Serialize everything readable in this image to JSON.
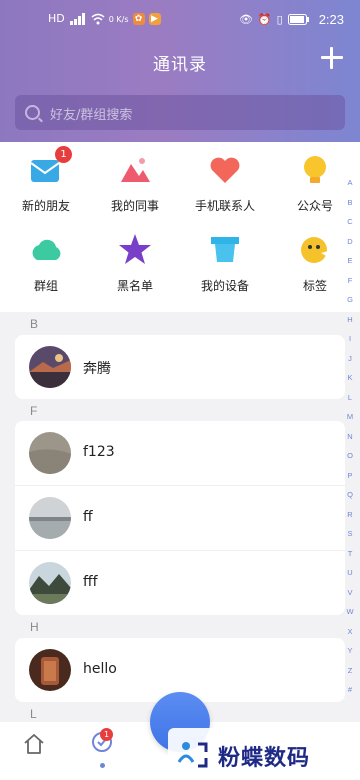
{
  "status_bar": {
    "left_text": "HD",
    "speed": "0 K/s",
    "time": "2:23"
  },
  "header": {
    "title": "通讯录"
  },
  "search": {
    "placeholder": "好友/群组搜索"
  },
  "quick_actions": [
    {
      "label": "新的朋友",
      "icon": "envelope-icon",
      "badge": "1"
    },
    {
      "label": "我的同事",
      "icon": "colleagues-icon"
    },
    {
      "label": "手机联系人",
      "icon": "heart-icon"
    },
    {
      "label": "公众号",
      "icon": "lightbulb-icon"
    },
    {
      "label": "群组",
      "icon": "cloud-icon"
    },
    {
      "label": "黑名单",
      "icon": "star-icon"
    },
    {
      "label": "我的设备",
      "icon": "device-icon"
    },
    {
      "label": "标签",
      "icon": "tag-icon"
    }
  ],
  "index_letters": [
    "A",
    "B",
    "C",
    "D",
    "E",
    "F",
    "G",
    "H",
    "I",
    "J",
    "K",
    "L",
    "M",
    "N",
    "O",
    "P",
    "Q",
    "R",
    "S",
    "T",
    "U",
    "V",
    "W",
    "X",
    "Y",
    "Z",
    "#"
  ],
  "sections": [
    {
      "letter": "B",
      "contacts": [
        {
          "name": "奔腾"
        }
      ]
    },
    {
      "letter": "F",
      "contacts": [
        {
          "name": "f123"
        },
        {
          "name": "ff"
        },
        {
          "name": "fff"
        }
      ]
    },
    {
      "letter": "H",
      "contacts": [
        {
          "name": "hello"
        }
      ]
    },
    {
      "letter": "L",
      "contacts": []
    }
  ],
  "bottom_nav": {
    "chat_badge": "1"
  },
  "watermark": {
    "text": "粉蝶数码"
  },
  "colors": {
    "header_gradient_start": "#8d78c0",
    "header_gradient_end": "#7d86d2",
    "accent": "#6f86d6",
    "badge": "#e83d3d"
  }
}
